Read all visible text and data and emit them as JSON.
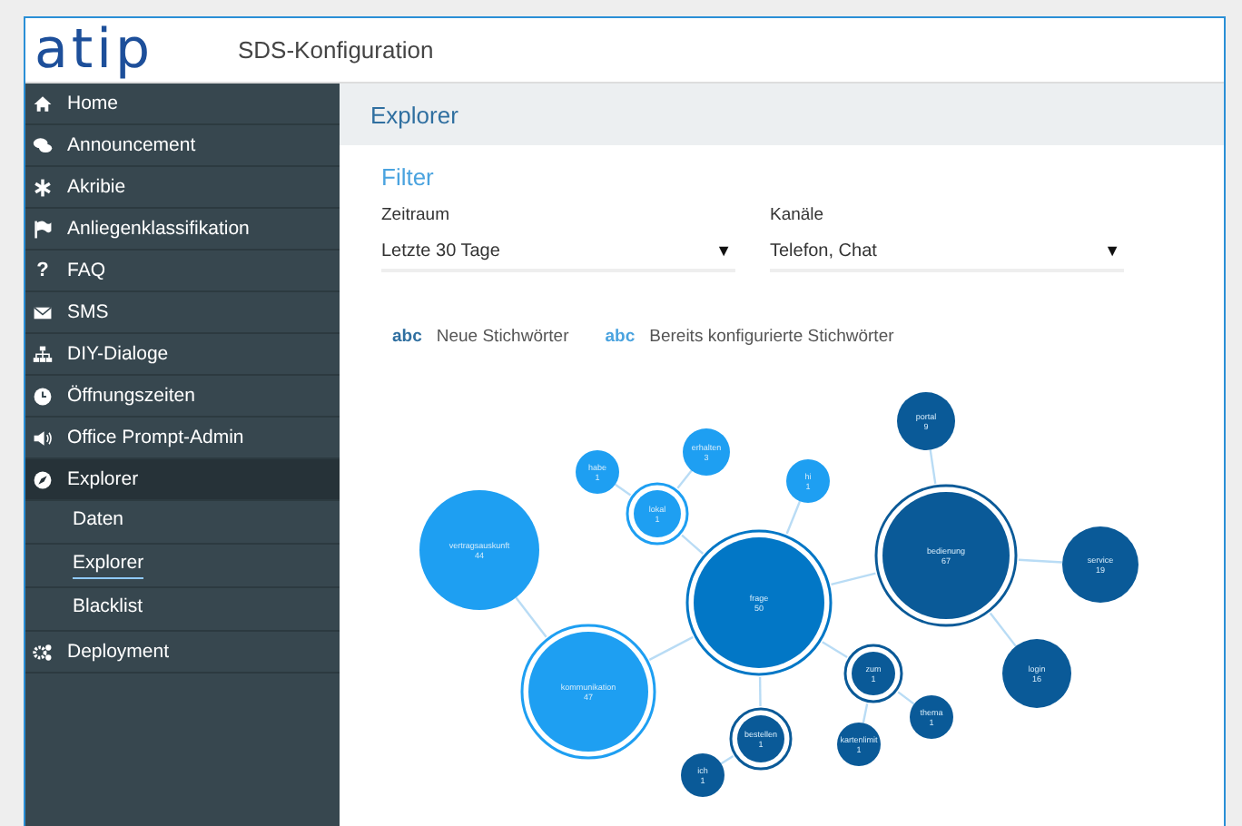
{
  "header": {
    "logo": "atip",
    "title": "SDS-Konfiguration"
  },
  "sidebar": {
    "items": [
      {
        "label": "Home",
        "selected": false
      },
      {
        "label": "Announcement",
        "selected": false
      },
      {
        "label": "Akribie",
        "selected": false
      },
      {
        "label": "Anliegenklassifikation",
        "selected": false
      },
      {
        "label": "FAQ",
        "glyph": "?",
        "selected": false
      },
      {
        "label": "SMS",
        "selected": false
      },
      {
        "label": "DIY-Dialoge",
        "selected": false
      },
      {
        "label": "Öffnungszeiten",
        "selected": false
      },
      {
        "label": "Office Prompt-Admin",
        "selected": false
      },
      {
        "label": "Explorer",
        "selected": true,
        "expanded": true,
        "children": [
          {
            "label": "Daten",
            "selected": false
          },
          {
            "label": "Explorer",
            "selected": true
          },
          {
            "label": "Blacklist",
            "selected": false
          }
        ]
      },
      {
        "label": "Deployment",
        "selected": false
      }
    ]
  },
  "page": {
    "title": "Explorer"
  },
  "filter": {
    "title": "Filter",
    "fields": [
      {
        "label": "Zeitraum",
        "value": "Letzte 30 Tage",
        "arrow": "▼"
      },
      {
        "label": "Kanäle",
        "value": "Telefon, Chat",
        "arrow": "▼"
      }
    ]
  },
  "legend": [
    {
      "marker": "abc",
      "label": "Neue Stichwörter",
      "color": "#2f6fa0"
    },
    {
      "marker": "abc",
      "label": "Bereits konfigurierte Stichwörter",
      "color": "#4aa3df"
    }
  ],
  "graph": {
    "root": {
      "label": "frage",
      "count": "50",
      "color": "#0277c6",
      "highlighted": true,
      "children": [
        {
          "label": "kommunikation",
          "count": "47",
          "color": "#1e9ff2",
          "highlighted": true,
          "children": [
            {
              "label": "vertragsauskunft",
              "count": "44",
              "color": "#1e9ff2",
              "highlighted": false
            }
          ]
        },
        {
          "label": "lokal",
          "count": "1",
          "color": "#1e9ff2",
          "highlighted": true,
          "children": [
            {
              "label": "habe",
              "count": "1",
              "color": "#1e9ff2",
              "highlighted": false
            },
            {
              "label": "erhalten",
              "count": "3",
              "color": "#1e9ff2",
              "highlighted": false
            }
          ]
        },
        {
          "label": "hi",
          "count": "1",
          "color": "#1e9ff2",
          "highlighted": false
        },
        {
          "label": "bedienung",
          "count": "67",
          "color": "#0a5a98",
          "highlighted": true,
          "children": [
            {
              "label": "portal",
              "count": "9",
              "color": "#0a5a98",
              "highlighted": false
            },
            {
              "label": "service",
              "count": "19",
              "color": "#0a5a98",
              "highlighted": false
            },
            {
              "label": "login",
              "count": "16",
              "color": "#0a5a98",
              "highlighted": false
            }
          ]
        },
        {
          "label": "bestellen",
          "count": "1",
          "color": "#0a5a98",
          "highlighted": true,
          "children": [
            {
              "label": "ich",
              "count": "1",
              "color": "#0a5a98",
              "highlighted": false
            }
          ]
        },
        {
          "label": "zum",
          "count": "1",
          "color": "#0a5a98",
          "highlighted": true,
          "children": [
            {
              "label": "thema",
              "count": "1",
              "color": "#0a5a98",
              "highlighted": false
            },
            {
              "label": "kartenlimit",
              "count": "1",
              "color": "#0a5a98",
              "highlighted": false
            }
          ]
        }
      ]
    }
  }
}
